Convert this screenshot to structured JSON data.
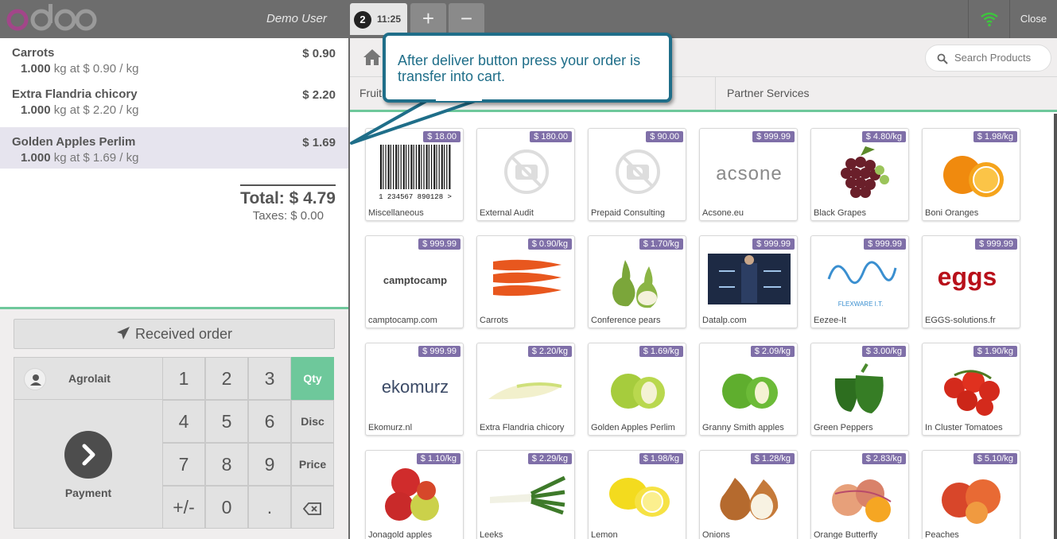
{
  "header": {
    "user": "Demo User",
    "order_number": "2",
    "order_time": "11:25",
    "add_label": "+",
    "remove_label": "−",
    "close_label": "Close"
  },
  "order": {
    "lines": [
      {
        "name": "Carrots",
        "price": "$ 0.90",
        "qty": "1.000",
        "unit_info": "kg at $ 0.90 / kg"
      },
      {
        "name": "Extra Flandria chicory",
        "price": "$ 2.20",
        "qty": "1.000",
        "unit_info": "kg at $ 2.20 / kg"
      },
      {
        "name": "Golden Apples Perlim",
        "price": "$ 1.69",
        "qty": "1.000",
        "unit_info": "kg at $ 1.69 / kg"
      }
    ],
    "total": "Total: $ 4.79",
    "taxes": "Taxes: $ 0.00"
  },
  "actions": {
    "received_order": "Received order",
    "customer": "Agrolait",
    "payment": "Payment"
  },
  "numpad": {
    "k1": "1",
    "k2": "2",
    "k3": "3",
    "qty": "Qty",
    "k4": "4",
    "k5": "5",
    "k6": "6",
    "disc": "Disc",
    "k7": "7",
    "k8": "8",
    "k9": "9",
    "price": "Price",
    "plusminus": "+/-",
    "k0": "0",
    "dot": "."
  },
  "search": {
    "placeholder": "Search Products"
  },
  "categories": [
    "Fruit",
    "Partner Services"
  ],
  "products": [
    {
      "name": "Miscellaneous",
      "price": "$ 18.00"
    },
    {
      "name": "External Audit",
      "price": "$ 180.00"
    },
    {
      "name": "Prepaid Consulting",
      "price": "$ 90.00"
    },
    {
      "name": "Acsone.eu",
      "price": "$ 999.99",
      "logo_text": "acsone"
    },
    {
      "name": "Black Grapes",
      "price": "$ 4.80/kg"
    },
    {
      "name": "Boni Oranges",
      "price": "$ 1.98/kg"
    },
    {
      "name": "camptocamp.com",
      "price": "$ 999.99",
      "logo_text": "camptocamp"
    },
    {
      "name": "Carrots",
      "price": "$ 0.90/kg"
    },
    {
      "name": "Conference pears",
      "price": "$ 1.70/kg"
    },
    {
      "name": "Datalp.com",
      "price": "$ 999.99"
    },
    {
      "name": "Eezee-It",
      "price": "$ 999.99",
      "logo_text": "FLEXWARE I.T."
    },
    {
      "name": "EGGS-solutions.fr",
      "price": "$ 999.99",
      "logo_text": "eggs"
    },
    {
      "name": "Ekomurz.nl",
      "price": "$ 999.99",
      "logo_text": "ekomurz"
    },
    {
      "name": "Extra Flandria chicory",
      "price": "$ 2.20/kg"
    },
    {
      "name": "Golden Apples Perlim",
      "price": "$ 1.69/kg"
    },
    {
      "name": "Granny Smith apples",
      "price": "$ 2.09/kg"
    },
    {
      "name": "Green Peppers",
      "price": "$ 3.00/kg"
    },
    {
      "name": "In Cluster Tomatoes",
      "price": "$ 1.90/kg"
    },
    {
      "name": "Jonagold apples",
      "price": "$ 1.10/kg"
    },
    {
      "name": "Leeks",
      "price": "$ 2.29/kg"
    },
    {
      "name": "Lemon",
      "price": "$ 1.98/kg"
    },
    {
      "name": "Onions",
      "price": "$ 1.28/kg"
    },
    {
      "name": "Orange Butterfly",
      "price": "$ 2.83/kg"
    },
    {
      "name": "Peaches",
      "price": "$ 5.10/kg"
    }
  ],
  "annotation": {
    "text": "After deliver button press your order is transfer into cart."
  },
  "colors": {
    "accent": "#6ec89b",
    "price_badge": "#7f6fa8",
    "callout": "#1f6e89",
    "topbar": "#6d6d6d"
  }
}
